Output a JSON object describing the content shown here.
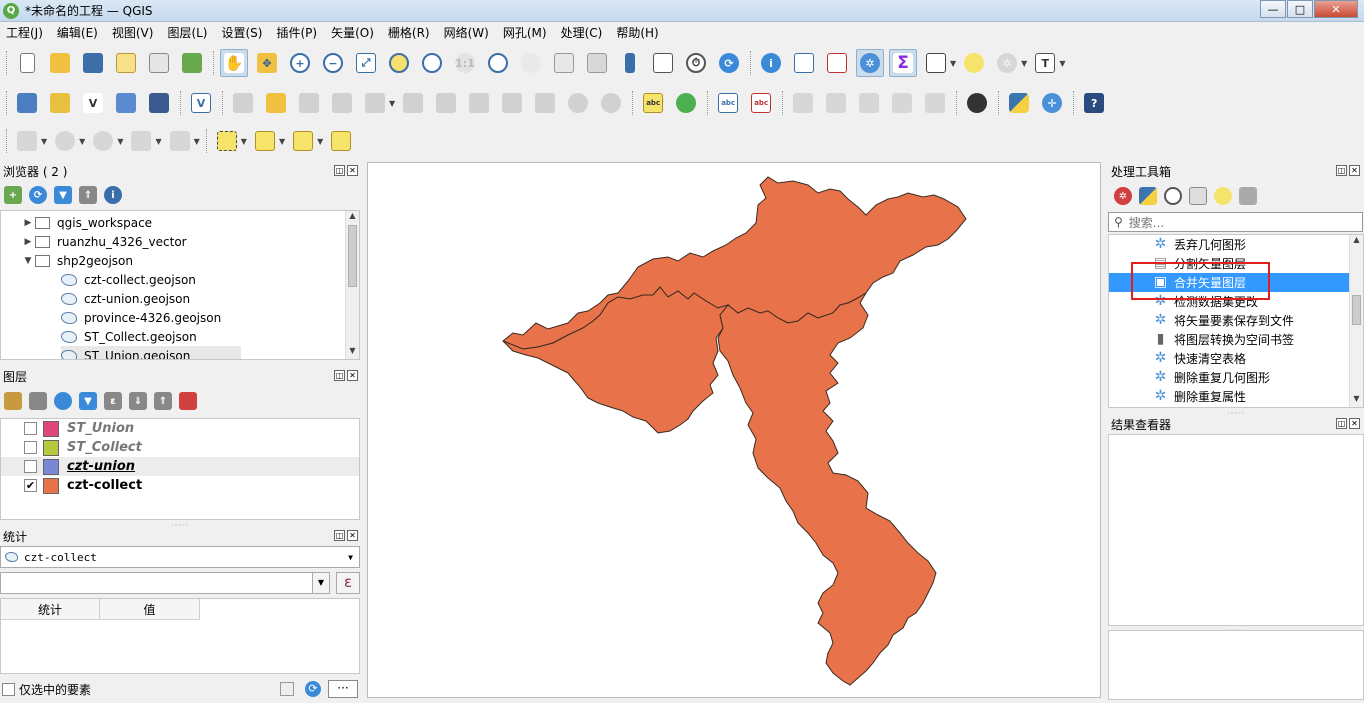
{
  "window": {
    "title": "*未命名的工程 — QGIS",
    "logo_letter": "Q",
    "minimize": "—",
    "maximize": "□",
    "close": "✕"
  },
  "menu": [
    "工程(J)",
    "编辑(E)",
    "视图(V)",
    "图层(L)",
    "设置(S)",
    "插件(P)",
    "矢量(O)",
    "栅格(R)",
    "网络(W)",
    "网孔(M)",
    "处理(C)",
    "帮助(H)"
  ],
  "browser": {
    "title": "浏览器 ( 2 )",
    "items": [
      {
        "label": "qgis_workspace",
        "type": "folder",
        "expanded": false
      },
      {
        "label": "ruanzhu_4326_vector",
        "type": "folder",
        "expanded": false
      },
      {
        "label": "shp2geojson",
        "type": "folder",
        "expanded": true
      },
      {
        "label": "czt-collect.geojson",
        "type": "geojson"
      },
      {
        "label": "czt-union.geojson",
        "type": "geojson"
      },
      {
        "label": "province-4326.geojson",
        "type": "geojson"
      },
      {
        "label": "ST_Collect.geojson",
        "type": "geojson"
      },
      {
        "label": "ST_Union.geojson",
        "type": "geojson"
      }
    ]
  },
  "layers": {
    "title": "图层",
    "items": [
      {
        "name": "ST_Union",
        "checked": false,
        "color": "#e0487a",
        "muted": true
      },
      {
        "name": "ST_Collect",
        "checked": false,
        "color": "#b6c83c",
        "muted": true
      },
      {
        "name": "czt-union",
        "checked": false,
        "color": "#7a86d6",
        "muted": false,
        "underline": true
      },
      {
        "name": "czt-collect",
        "checked": true,
        "color": "#e8734a",
        "muted": false
      }
    ],
    "check_mark": "✔"
  },
  "stats": {
    "title": "统计",
    "layer": "czt-collect",
    "expr_button": "ε",
    "col_stat": "统计",
    "col_value": "值",
    "selected_only": "仅选中的要素",
    "more": "···"
  },
  "toolbox": {
    "title": "处理工具箱",
    "search_placeholder": "搜索...",
    "algorithms": [
      {
        "label": "丢弃几何图形",
        "selected": false
      },
      {
        "label": "分割矢量图层",
        "selected": false
      },
      {
        "label": "合并矢量图层",
        "selected": true
      },
      {
        "label": "检测数据集更改",
        "selected": false
      },
      {
        "label": "将矢量要素保存到文件",
        "selected": false
      },
      {
        "label": "将图层转换为空间书签",
        "selected": false
      },
      {
        "label": "快速清空表格",
        "selected": false
      },
      {
        "label": "删除重复几何图形",
        "selected": false
      },
      {
        "label": "删除重复属性",
        "selected": false
      }
    ]
  },
  "results": {
    "title": "结果查看器"
  },
  "map": {
    "fill": "#e8734a",
    "stroke": "#3a2a20"
  }
}
